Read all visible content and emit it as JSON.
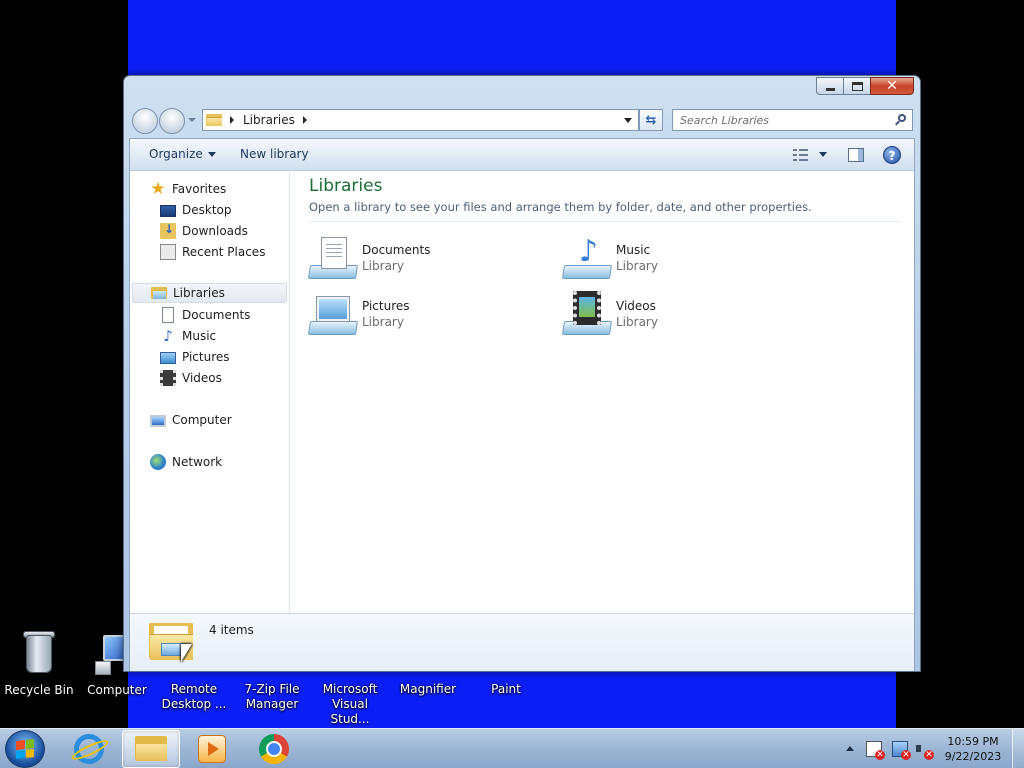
{
  "desktop": {
    "icons": [
      {
        "label": "Recycle Bin",
        "icon": "recycle-bin-icon"
      },
      {
        "label": "Computer",
        "icon": "computer-icon"
      },
      {
        "label": "Remote Desktop ...",
        "icon": "remote-desktop-icon"
      },
      {
        "label": "7-Zip File Manager",
        "icon": "7zip-icon"
      },
      {
        "label": "Microsoft Visual Stud...",
        "icon": "visual-studio-icon"
      },
      {
        "label": "Magnifier",
        "icon": "magnifier-icon"
      },
      {
        "label": "Paint",
        "icon": "paint-icon"
      }
    ],
    "background_color": "#0b1ef5"
  },
  "window": {
    "address": {
      "segment": "Libraries"
    },
    "search": {
      "placeholder": "Search Libraries"
    },
    "toolbar": {
      "organize": "Organize",
      "new_library": "New library"
    },
    "help_label": "?",
    "sidebar": {
      "favorites": {
        "header": "Favorites",
        "items": [
          {
            "label": "Desktop",
            "icon": "desktop-icon"
          },
          {
            "label": "Downloads",
            "icon": "downloads-icon"
          },
          {
            "label": "Recent Places",
            "icon": "recent-places-icon"
          }
        ]
      },
      "libraries": {
        "header": "Libraries",
        "items": [
          {
            "label": "Documents",
            "icon": "documents-icon"
          },
          {
            "label": "Music",
            "icon": "music-icon"
          },
          {
            "label": "Pictures",
            "icon": "pictures-icon"
          },
          {
            "label": "Videos",
            "icon": "videos-icon"
          }
        ]
      },
      "computer": "Computer",
      "network": "Network"
    },
    "main": {
      "title": "Libraries",
      "subtitle": "Open a library to see your files and arrange them by folder, date, and other properties.",
      "items": [
        {
          "name": "Documents",
          "kind": "Library",
          "icon": "documents-library-icon"
        },
        {
          "name": "Music",
          "kind": "Library",
          "icon": "music-library-icon"
        },
        {
          "name": "Pictures",
          "kind": "Library",
          "icon": "pictures-library-icon"
        },
        {
          "name": "Videos",
          "kind": "Library",
          "icon": "videos-library-icon"
        }
      ]
    },
    "details": {
      "count": "4 items"
    }
  },
  "taskbar": {
    "apps": [
      {
        "name": "Internet Explorer",
        "icon": "internet-explorer-icon"
      },
      {
        "name": "Windows Explorer",
        "icon": "windows-explorer-icon",
        "active": true
      },
      {
        "name": "Windows Media Player",
        "icon": "media-player-icon"
      },
      {
        "name": "Google Chrome",
        "icon": "chrome-icon"
      }
    ],
    "clock": {
      "time": "10:59 PM",
      "date": "9/22/2023"
    }
  },
  "colors": {
    "title_green": "#1d6c36",
    "desktop_blue": "#0b1ef5"
  }
}
